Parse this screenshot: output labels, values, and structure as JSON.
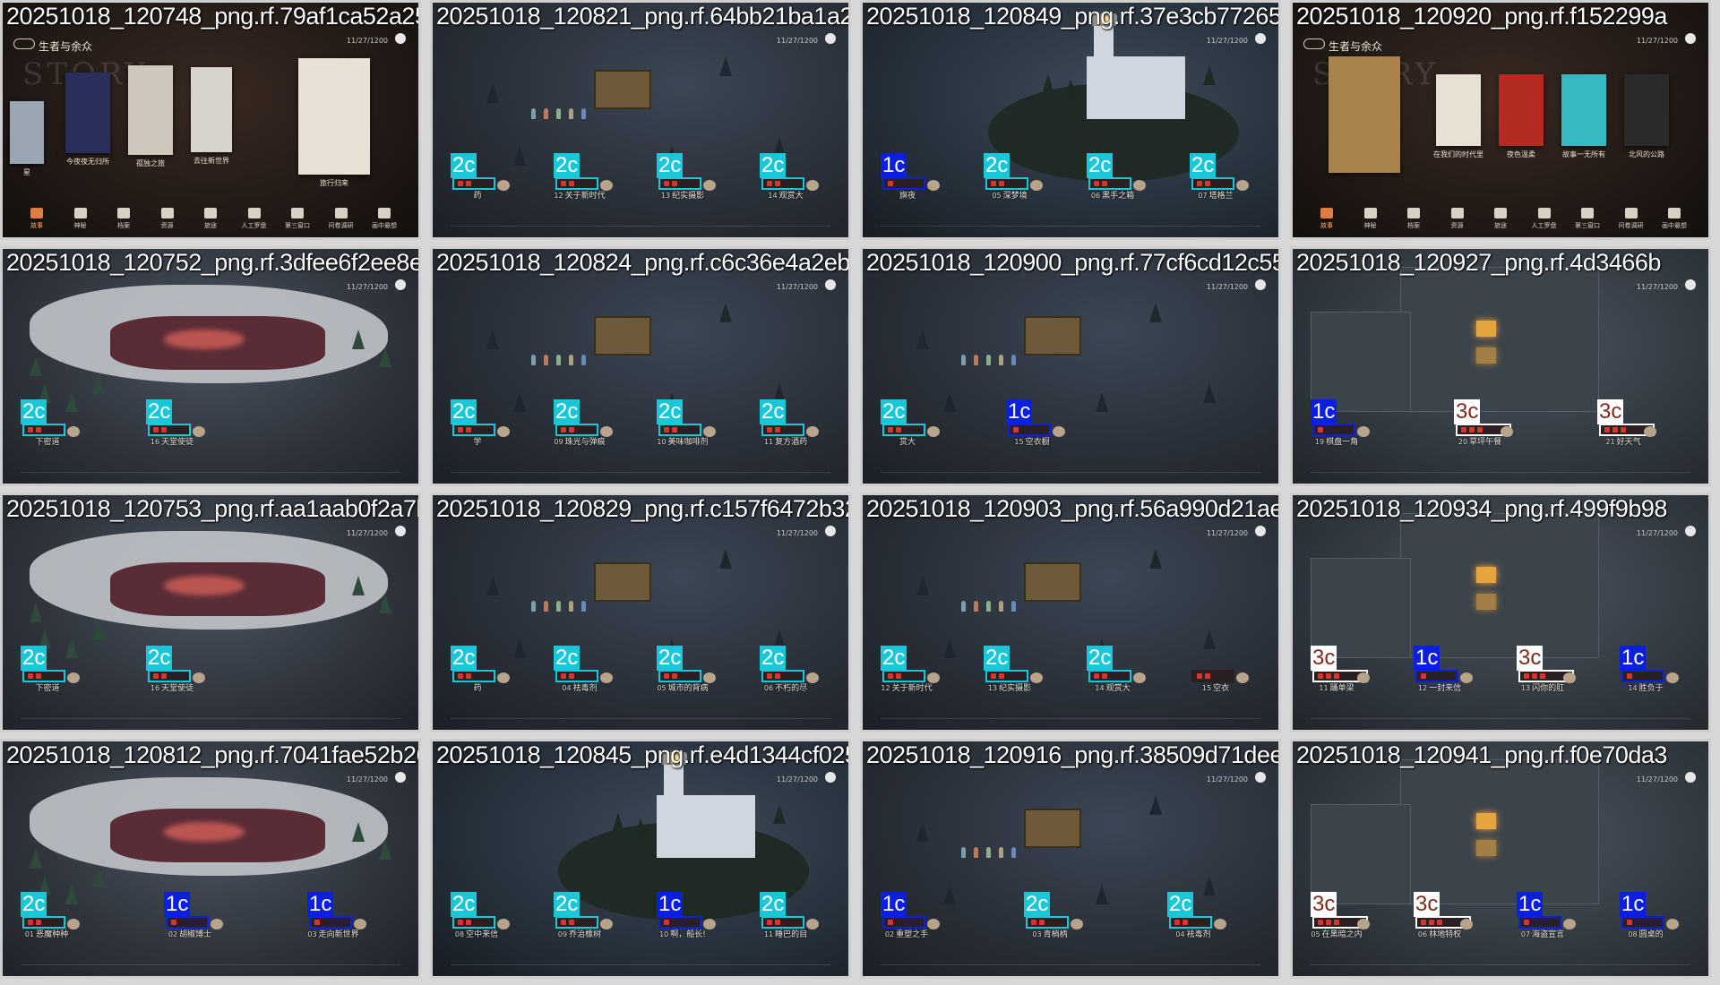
{
  "hud_time": "11/27/1200",
  "story_menu": {
    "title": "生者与余众",
    "bg_word": "STORY",
    "menu_items": [
      "故事",
      "神秘",
      "档案",
      "资源",
      "旅途",
      "人工罗盘",
      "第三窗口",
      "问卷调研",
      "画中悬想"
    ],
    "books_a": [
      "星",
      "今夜夜无归所",
      "孤独之旅",
      "去往新世界",
      "旅行归来"
    ],
    "books_b": [
      "在我们的时代里",
      "夜色温柔",
      "故事一无所有",
      "北风的公路"
    ]
  },
  "tiles": [
    {
      "file": "20251018_120748_png.rf.79af1ca52a251baee",
      "kind": "story_a",
      "cards": []
    },
    {
      "file": "20251018_120821_png.rf.64bb21ba1a2b8dc89",
      "kind": "lake",
      "cards": [
        {
          "badge": "2c",
          "num": "",
          "label": "药"
        },
        {
          "badge": "2c",
          "num": "12",
          "label": "关于新时代"
        },
        {
          "badge": "2c",
          "num": "13",
          "label": "纪实摄影"
        },
        {
          "badge": "2c",
          "num": "14",
          "label": "观赏大"
        }
      ]
    },
    {
      "file": "20251018_120849_png.rf.37e3cb77265a1e3a3",
      "kind": "lighthouse",
      "cards": [
        {
          "badge": "1c",
          "num": "",
          "label": "旗夜"
        },
        {
          "badge": "2c",
          "num": "05",
          "label": "深梦境"
        },
        {
          "badge": "2c",
          "num": "06",
          "label": "黑手之箱"
        },
        {
          "badge": "2c",
          "num": "07",
          "label": "塔格兰"
        }
      ]
    },
    {
      "file": "20251018_120920_png.rf.f152299a",
      "kind": "story_b",
      "cards": []
    },
    {
      "file": "20251018_120752_png.rf.3dfee6f2ee8ebab67",
      "kind": "snow",
      "cards": [
        {
          "badge": "2c",
          "num": "",
          "label": "下密道"
        },
        {
          "badge": "2c",
          "num": "16",
          "label": "天堂使徒"
        }
      ]
    },
    {
      "file": "20251018_120824_png.rf.c6c36e4a2eb5bd8b4",
      "kind": "lake",
      "cards": [
        {
          "badge": "2c",
          "num": "",
          "label": "学"
        },
        {
          "badge": "2c",
          "num": "09",
          "label": "珠光与弹痕"
        },
        {
          "badge": "2c",
          "num": "10",
          "label": "美味咖啡剂"
        },
        {
          "badge": "2c",
          "num": "11",
          "label": "复方酒药"
        }
      ]
    },
    {
      "file": "20251018_120900_png.rf.77cf6cd12c55100be",
      "kind": "lake",
      "cards": [
        {
          "badge": "2c",
          "num": "",
          "label": "赏大"
        },
        {
          "badge": "1c",
          "num": "15",
          "label": "空衣橱"
        }
      ]
    },
    {
      "file": "20251018_120927_png.rf.4d3466b",
      "kind": "tower",
      "cards": [
        {
          "badge": "1c",
          "num": "19",
          "label": "棋盘一角"
        },
        {
          "badge": "3c",
          "num": "20",
          "label": "草坪午餐"
        },
        {
          "badge": "3c",
          "num": "21",
          "label": "好天气"
        }
      ]
    },
    {
      "file": "20251018_120753_png.rf.aa1aab0f2a7b84584",
      "kind": "snow",
      "cards": [
        {
          "badge": "2c",
          "num": "",
          "label": "下密道"
        },
        {
          "badge": "2c",
          "num": "16",
          "label": "天堂使徒"
        }
      ]
    },
    {
      "file": "20251018_120829_png.rf.c157f6472b3210689",
      "kind": "lake",
      "cards": [
        {
          "badge": "2c",
          "num": "",
          "label": "药"
        },
        {
          "badge": "2c",
          "num": "04",
          "label": "祛毒剂"
        },
        {
          "badge": "2c",
          "num": "05",
          "label": "城市的背病"
        },
        {
          "badge": "2c",
          "num": "06",
          "label": "不朽的尽"
        }
      ]
    },
    {
      "file": "20251018_120903_png.rf.56a990d21aeda9a68",
      "kind": "lake",
      "cards": [
        {
          "badge": "2c",
          "num": "12",
          "label": "关于新时代"
        },
        {
          "badge": "2c",
          "num": "13",
          "label": "纪实摄影"
        },
        {
          "badge": "2c",
          "num": "14",
          "label": "观赏大"
        },
        {
          "badge": "",
          "num": "15",
          "label": "空衣"
        }
      ]
    },
    {
      "file": "20251018_120934_png.rf.499f9b98",
      "kind": "tower",
      "cards": [
        {
          "badge": "3c",
          "num": "11",
          "label": "踊单梁"
        },
        {
          "badge": "1c",
          "num": "12",
          "label": "一封来信"
        },
        {
          "badge": "3c",
          "num": "13",
          "label": "闪你的肛"
        },
        {
          "badge": "1c",
          "num": "14",
          "label": "胜负于"
        }
      ]
    },
    {
      "file": "20251018_120812_png.rf.7041fae52b26b3028",
      "kind": "snow",
      "cards": [
        {
          "badge": "2c",
          "num": "01",
          "label": "恶魔种种"
        },
        {
          "badge": "1c",
          "num": "02",
          "label": "胡椒博士"
        },
        {
          "badge": "1c",
          "num": "03",
          "label": "走向新世界"
        }
      ]
    },
    {
      "file": "20251018_120845_png.rf.e4d1344cf0254f00f",
      "kind": "lighthouse",
      "cards": [
        {
          "badge": "2c",
          "num": "08",
          "label": "空中来信"
        },
        {
          "badge": "2c",
          "num": "09",
          "label": "乔治橡树"
        },
        {
          "badge": "1c",
          "num": "10",
          "label": "啊，船长!"
        },
        {
          "badge": "2c",
          "num": "11",
          "label": "睡巴的目"
        }
      ]
    },
    {
      "file": "20251018_120916_png.rf.38509d71deee4185",
      "kind": "lake",
      "cards": [
        {
          "badge": "1c",
          "num": "02",
          "label": "重塑之手"
        },
        {
          "badge": "2c",
          "num": "03",
          "label": "青梢柄"
        },
        {
          "badge": "2c",
          "num": "04",
          "label": "祛毒剂"
        }
      ]
    },
    {
      "file": "20251018_120941_png.rf.f0e70da3",
      "kind": "tower",
      "cards": [
        {
          "badge": "3c",
          "num": "05",
          "label": "在黑暗之内"
        },
        {
          "badge": "3c",
          "num": "06",
          "label": "林地特权"
        },
        {
          "badge": "1c",
          "num": "07",
          "label": "海盗宣言"
        },
        {
          "badge": "1c",
          "num": "08",
          "label": "圆桌的"
        }
      ]
    }
  ]
}
